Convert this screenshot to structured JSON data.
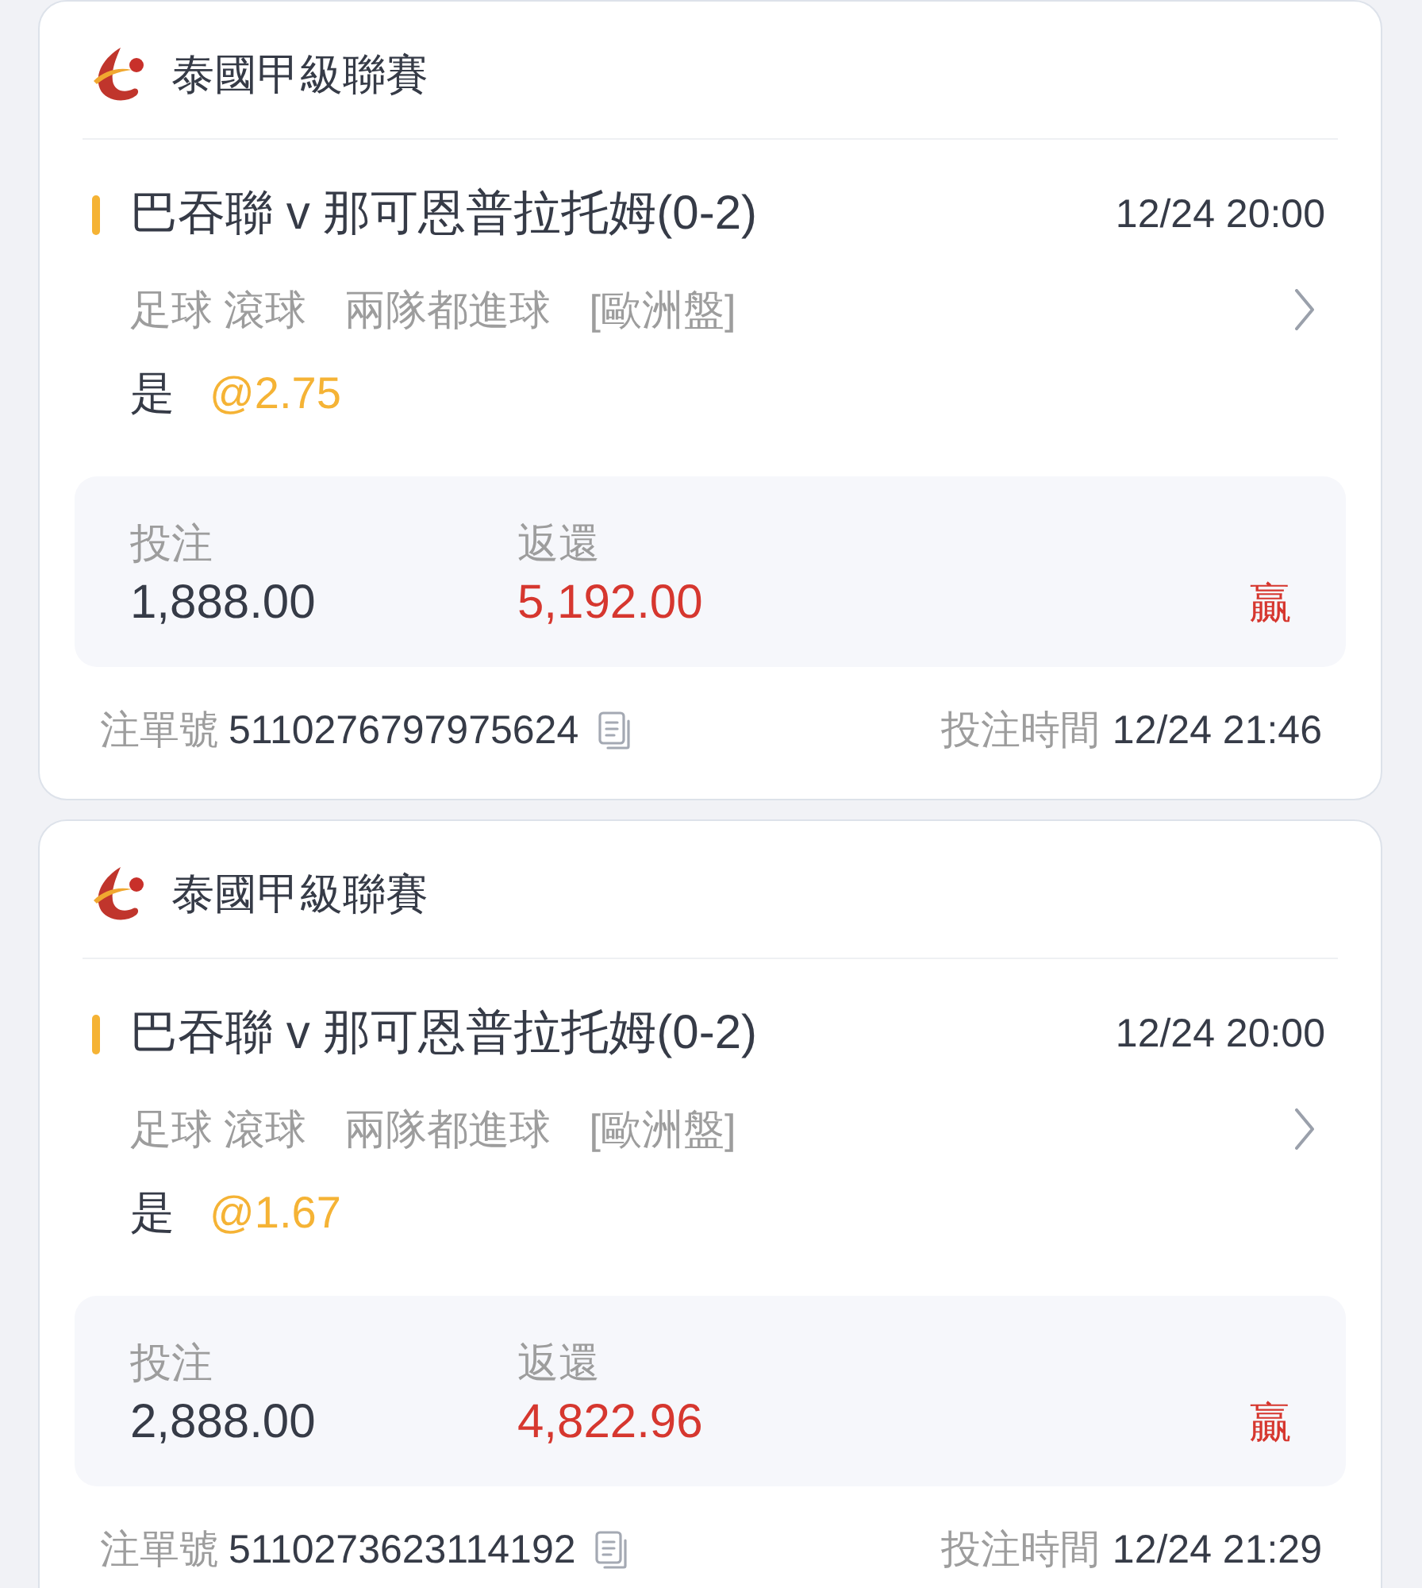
{
  "bets": [
    {
      "league": "泰國甲級聯賽",
      "match": "巴吞聯 v 那可恩普拉托姆(0-2)",
      "kickoff": "12/24 20:00",
      "market": [
        "足球 滾球",
        "兩隊都進球",
        "[歐洲盤]"
      ],
      "selection": "是",
      "odds": "@2.75",
      "stake_label": "投注",
      "stake": "1,888.00",
      "return_label": "返還",
      "return": "5,192.00",
      "result": "贏",
      "ticket_label": "注單號",
      "ticket_no": "5110276797975624",
      "placed_label": "投注時間",
      "placed_time": "12/24 21:46"
    },
    {
      "league": "泰國甲級聯賽",
      "match": "巴吞聯 v 那可恩普拉托姆(0-2)",
      "kickoff": "12/24 20:00",
      "market": [
        "足球 滾球",
        "兩隊都進球",
        "[歐洲盤]"
      ],
      "selection": "是",
      "odds": "@1.67",
      "stake_label": "投注",
      "stake": "2,888.00",
      "return_label": "返還",
      "return": "4,822.96",
      "result": "贏",
      "ticket_label": "注單號",
      "ticket_no": "5110273623114192",
      "placed_label": "投注時間",
      "placed_time": "12/24 21:29"
    }
  ]
}
